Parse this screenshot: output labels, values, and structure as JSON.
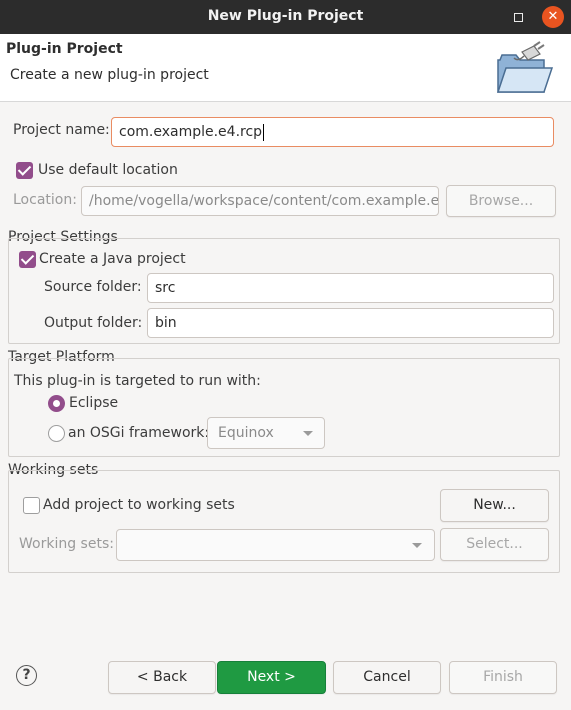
{
  "window": {
    "title": "New Plug-in Project"
  },
  "header": {
    "title": "Plug-in Project",
    "description": "Create a new plug-in project"
  },
  "project_name": {
    "label": "Project name:",
    "value": "com.example.e4.rcp"
  },
  "location": {
    "use_default_label": "Use default location",
    "use_default_checked": true,
    "label": "Location:",
    "value": "/home/vogella/workspace/content/com.example.e",
    "browse_label": "Browse..."
  },
  "project_settings": {
    "title": "Project Settings",
    "create_java_label": "Create a Java project",
    "create_java_checked": true,
    "source_label": "Source folder:",
    "source_value": "src",
    "output_label": "Output folder:",
    "output_value": "bin"
  },
  "target_platform": {
    "title": "Target Platform",
    "intro": "This plug-in is targeted to run with:",
    "eclipse_label": "Eclipse",
    "osgi_label": "an OSGi framework:",
    "selected": "Eclipse",
    "framework_value": "Equinox"
  },
  "working_sets": {
    "title": "Working sets",
    "add_label": "Add project to working sets",
    "add_checked": false,
    "new_label": "New...",
    "sets_label": "Working sets:",
    "select_label": "Select..."
  },
  "footer": {
    "back_label": "< Back",
    "next_label": "Next >",
    "cancel_label": "Cancel",
    "finish_label": "Finish"
  },
  "icons": {
    "help": "help-icon",
    "close": "close-icon",
    "maximize": "maximize-icon",
    "wizard": "folder-plug-icon"
  },
  "colors": {
    "accent": "#924d8b",
    "primary_button": "#1f9a42",
    "close_button": "#e95420",
    "focus_border": "#e98c62"
  }
}
